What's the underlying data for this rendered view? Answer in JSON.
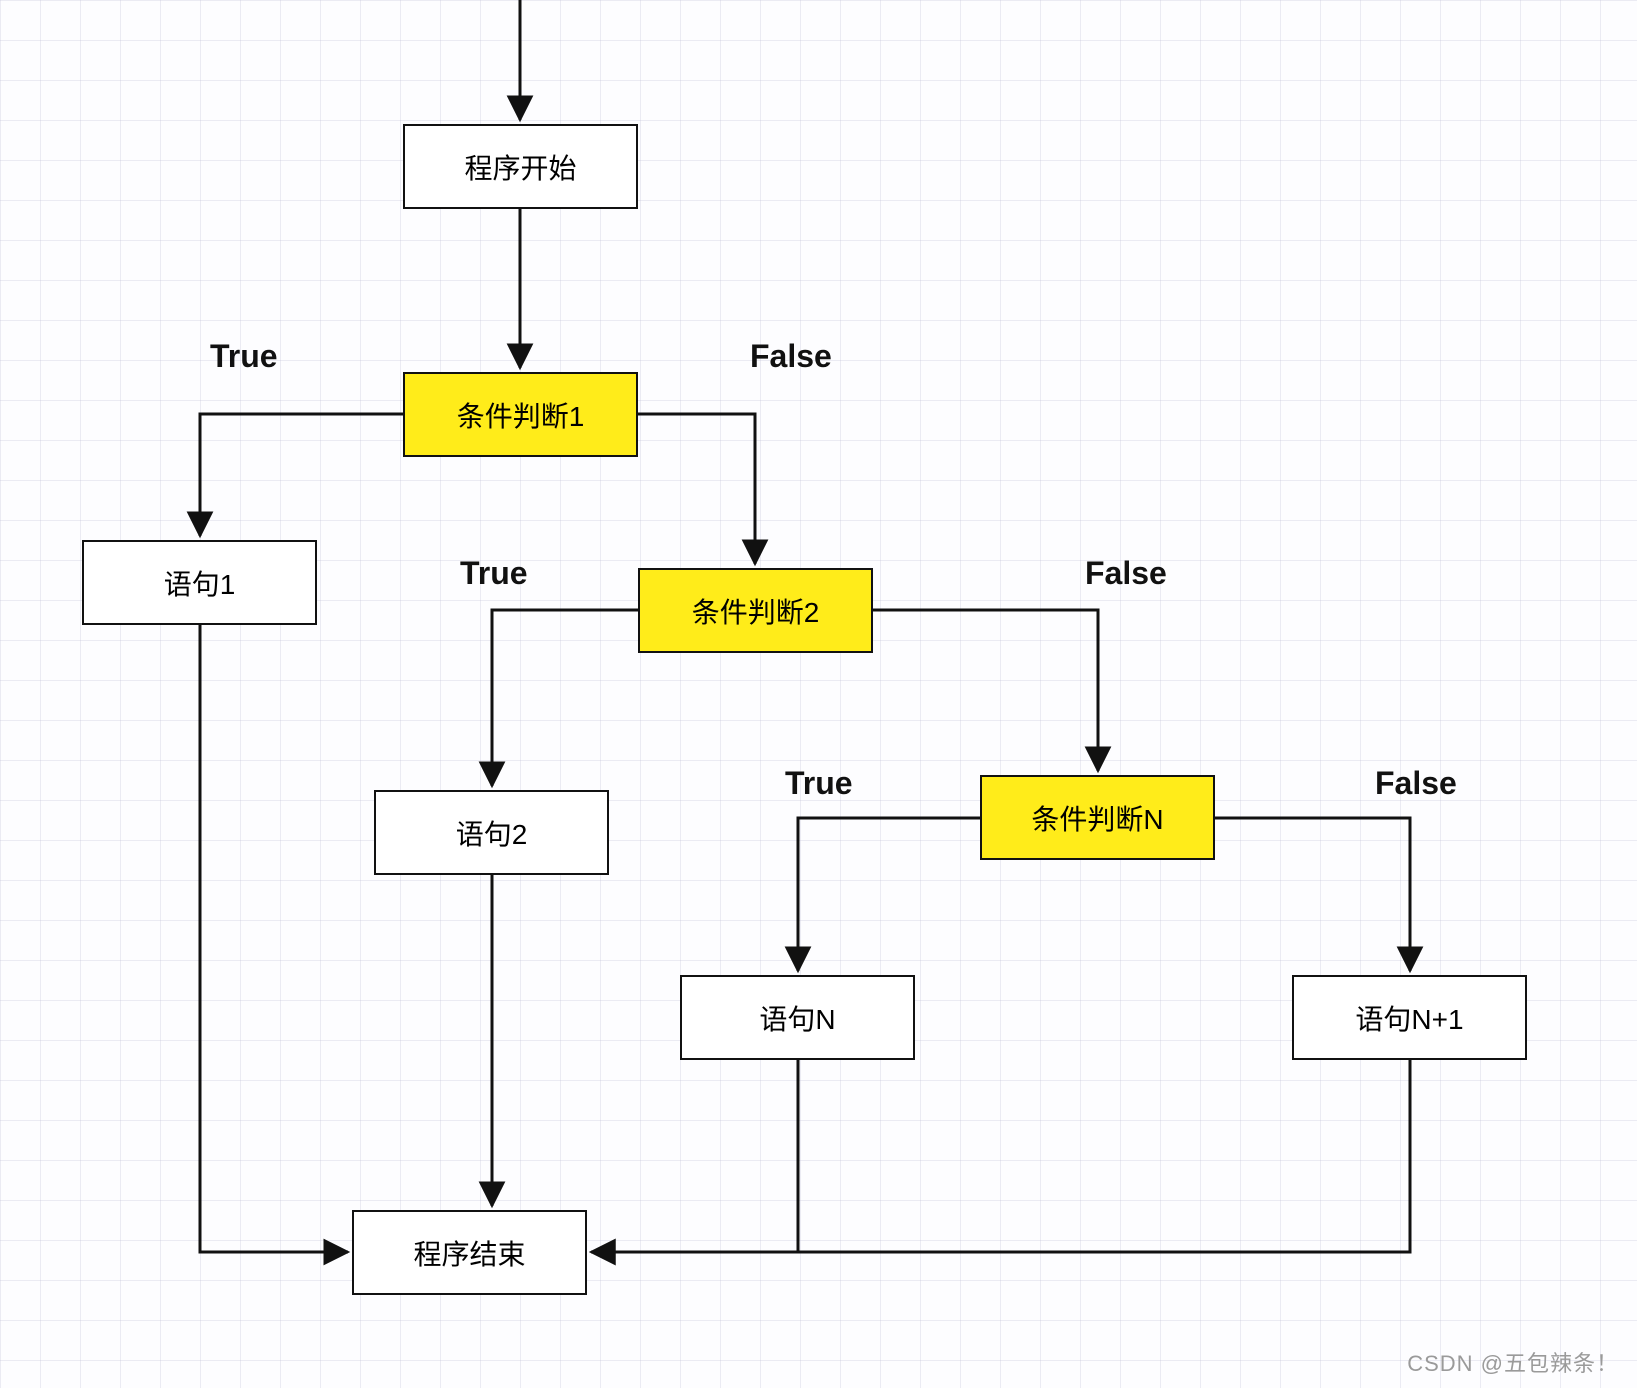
{
  "nodes": {
    "start": {
      "text": "程序开始"
    },
    "cond1": {
      "text": "条件判断1"
    },
    "cond2": {
      "text": "条件判断2"
    },
    "condN": {
      "text": "条件判断N"
    },
    "stmt1": {
      "text": "语句1"
    },
    "stmt2": {
      "text": "语句2"
    },
    "stmtN": {
      "text": "语句N"
    },
    "stmtN1": {
      "text": "语句N+1"
    },
    "end": {
      "text": "程序结束"
    }
  },
  "labels": {
    "true1": "True",
    "false1": "False",
    "true2": "True",
    "false2": "False",
    "trueN": "True",
    "falseN": "False"
  },
  "watermark": "CSDN @五包辣条！"
}
